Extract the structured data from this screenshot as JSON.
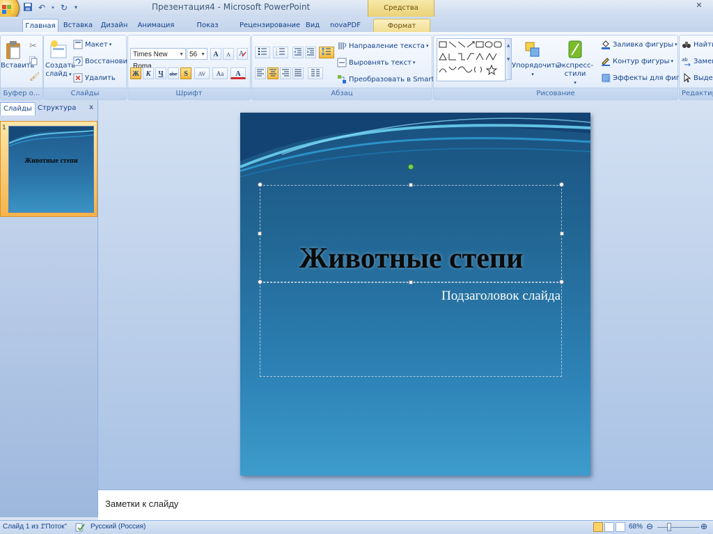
{
  "window": {
    "title": "Презентация4 - Microsoft PowerPoint",
    "context_tab_header": "Средства рисования"
  },
  "tabs": [
    "Главная",
    "Вставка",
    "Дизайн",
    "Анимация",
    "Показ слайдов",
    "Рецензирование",
    "Вид",
    "novaPDF",
    "Формат"
  ],
  "ribbon": {
    "clipboard": {
      "paste": "Вставить",
      "label": "Буфер о..."
    },
    "slides": {
      "new_slide_line1": "Создать",
      "new_slide_line2": "слайд",
      "layout": "Макет",
      "reset": "Восстановить",
      "delete": "Удалить",
      "label": "Слайды"
    },
    "font": {
      "font_name": "Times New Roma",
      "font_size": "56",
      "grow": "A",
      "shrink": "A",
      "bold": "Ж",
      "italic": "К",
      "underline": "Ч",
      "strike": "abe",
      "shadow": "S",
      "spacing": "AV",
      "case": "Aa",
      "color": "A",
      "label": "Шрифт"
    },
    "paragraph": {
      "text_direction": "Направление текста",
      "align_text": "Выровнять текст",
      "smartart": "Преобразовать в SmartArt",
      "label": "Абзац"
    },
    "drawing": {
      "arrange": "Упорядочить",
      "quick_styles": "Экспресс-стили",
      "shape_fill": "Заливка фигуры",
      "shape_outline": "Контур фигуры",
      "shape_effects": "Эффекты для фигур",
      "label": "Рисование"
    },
    "editing": {
      "find": "Найти",
      "replace": "Замен",
      "select": "Выдел",
      "label": "Редактиров"
    }
  },
  "left_panel": {
    "tab_slides": "Слайды",
    "tab_outline": "Структура",
    "close": "x",
    "thumbnail": {
      "number": "1",
      "title": "Животные степи"
    }
  },
  "slide": {
    "title": "Животные степи",
    "subtitle": "Подзаголовок слайда"
  },
  "notes": {
    "text": "Заметки к слайду"
  },
  "statusbar": {
    "slide_info": "Слайд 1 из 1",
    "theme": "\"Поток\"",
    "language": "Русский (Россия)",
    "zoom": "68%"
  },
  "colors": {
    "slide_top": "#19507f",
    "slide_bottom": "#3e9ccc",
    "ribbon_accent": "#8db2e3"
  }
}
